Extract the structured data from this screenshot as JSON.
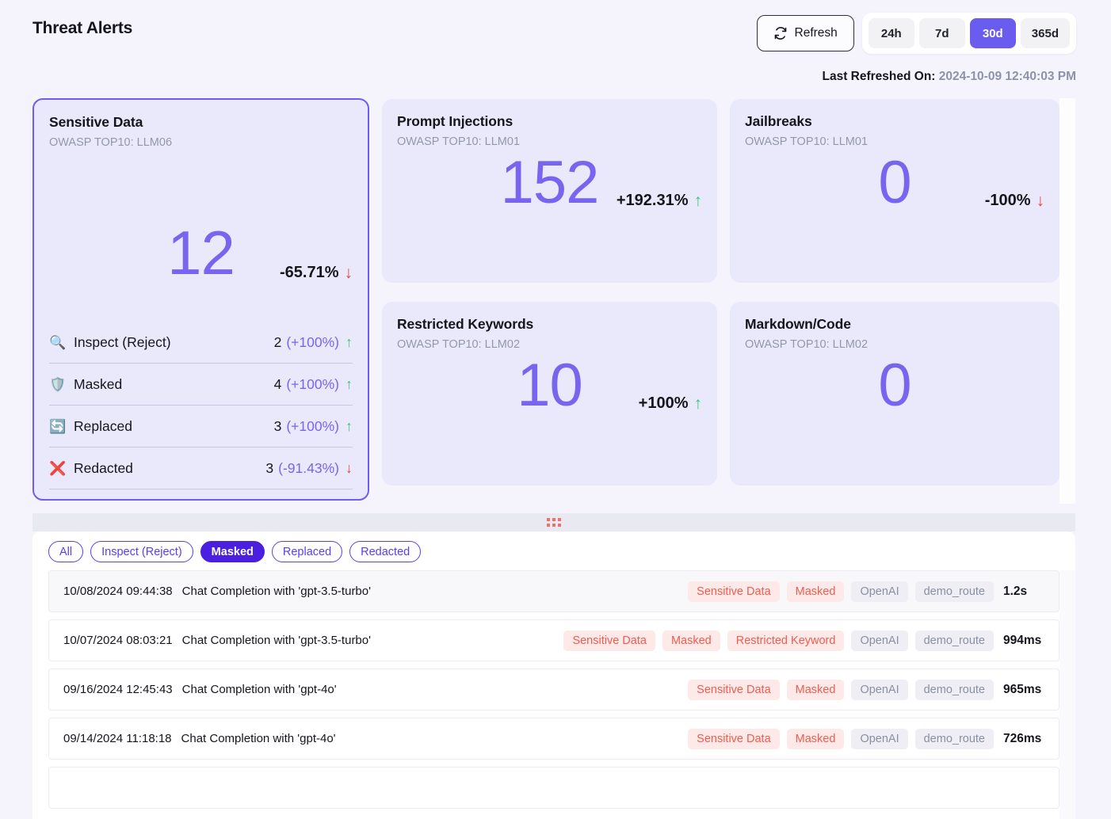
{
  "header": {
    "title": "Threat Alerts",
    "refresh_label": "Refresh",
    "refresh_icon": "refresh-icon",
    "ranges": [
      {
        "label": "24h",
        "active": false
      },
      {
        "label": "7d",
        "active": false
      },
      {
        "label": "30d",
        "active": true
      },
      {
        "label": "365d",
        "active": false
      }
    ],
    "last_refreshed_label": "Last Refreshed On:",
    "last_refreshed_value": "2024-10-09 12:40:03 PM"
  },
  "colors": {
    "accent": "#6b5cf0",
    "metric": "#7765f0",
    "up": "#3ec47f",
    "down": "#ef4136",
    "danger_tag_text": "#ef5c50",
    "danger_tag_bg": "#fdeae8",
    "neutral_tag_text": "#8a8fa3",
    "neutral_tag_bg": "#eeeef4",
    "page_bg": "#f5f4fd",
    "card_bg": "#eae9fc",
    "chip_active_bg": "#4a1fe0"
  },
  "cards": {
    "sensitive": {
      "title": "Sensitive Data",
      "subtitle": "OWASP TOP10: LLM06",
      "value": "12",
      "delta": "-65.71%",
      "direction": "down",
      "direction_glyph": "↓",
      "breakdown": [
        {
          "icon": "🔍",
          "icon_name": "magnifier-icon",
          "label": "Inspect (Reject)",
          "count": "2",
          "pct": "(+100%)",
          "direction": "up",
          "direction_glyph": "↑"
        },
        {
          "icon": "🛡️",
          "icon_name": "shield-icon",
          "label": "Masked",
          "count": "4",
          "pct": "(+100%)",
          "direction": "up",
          "direction_glyph": "↑"
        },
        {
          "icon": "🔄",
          "icon_name": "replace-arrows-icon",
          "label": "Replaced",
          "count": "3",
          "pct": "(+100%)",
          "direction": "up",
          "direction_glyph": "↑"
        },
        {
          "icon": "❌",
          "icon_name": "red-cross-icon",
          "label": "Redacted",
          "count": "3",
          "pct": "(-91.43%)",
          "direction": "down",
          "direction_glyph": "↓"
        }
      ]
    },
    "prompt_injections": {
      "title": "Prompt Injections",
      "subtitle": "OWASP TOP10: LLM01",
      "value": "152",
      "delta": "+192.31%",
      "direction": "up",
      "direction_glyph": "↑"
    },
    "jailbreaks": {
      "title": "Jailbreaks",
      "subtitle": "OWASP TOP10: LLM01",
      "value": "0",
      "delta": "-100%",
      "direction": "down",
      "direction_glyph": "↓"
    },
    "restricted_keywords": {
      "title": "Restricted Keywords",
      "subtitle": "OWASP TOP10: LLM02",
      "value": "10",
      "delta": "+100%",
      "direction": "up",
      "direction_glyph": "↑"
    },
    "markdown_code": {
      "title": "Markdown/Code",
      "subtitle": "OWASP TOP10: LLM02",
      "value": "0",
      "delta": "",
      "direction": "",
      "direction_glyph": ""
    }
  },
  "splitter": {
    "handle_icon": "drag-handle-icon"
  },
  "filters": [
    {
      "label": "All",
      "active": false
    },
    {
      "label": "Inspect (Reject)",
      "active": false
    },
    {
      "label": "Masked",
      "active": true
    },
    {
      "label": "Replaced",
      "active": false
    },
    {
      "label": "Redacted",
      "active": false
    }
  ],
  "log_rows": [
    {
      "timestamp": "10/08/2024 09:44:38",
      "description": "Chat Completion with 'gpt-3.5-turbo'",
      "tags": [
        {
          "label": "Sensitive Data",
          "kind": "danger"
        },
        {
          "label": "Masked",
          "kind": "danger"
        },
        {
          "label": "OpenAI",
          "kind": "neutral"
        },
        {
          "label": "demo_route",
          "kind": "neutral"
        }
      ],
      "latency": "1.2s",
      "highlighted": true
    },
    {
      "timestamp": "10/07/2024 08:03:21",
      "description": "Chat Completion with 'gpt-3.5-turbo'",
      "tags": [
        {
          "label": "Sensitive Data",
          "kind": "danger"
        },
        {
          "label": "Masked",
          "kind": "danger"
        },
        {
          "label": "Restricted Keyword",
          "kind": "danger"
        },
        {
          "label": "OpenAI",
          "kind": "neutral"
        },
        {
          "label": "demo_route",
          "kind": "neutral"
        }
      ],
      "latency": "994ms",
      "highlighted": false
    },
    {
      "timestamp": "09/16/2024 12:45:43",
      "description": "Chat Completion with 'gpt-4o'",
      "tags": [
        {
          "label": "Sensitive Data",
          "kind": "danger"
        },
        {
          "label": "Masked",
          "kind": "danger"
        },
        {
          "label": "OpenAI",
          "kind": "neutral"
        },
        {
          "label": "demo_route",
          "kind": "neutral"
        }
      ],
      "latency": "965ms",
      "highlighted": false
    },
    {
      "timestamp": "09/14/2024 11:18:18",
      "description": "Chat Completion with 'gpt-4o'",
      "tags": [
        {
          "label": "Sensitive Data",
          "kind": "danger"
        },
        {
          "label": "Masked",
          "kind": "danger"
        },
        {
          "label": "OpenAI",
          "kind": "neutral"
        },
        {
          "label": "demo_route",
          "kind": "neutral"
        }
      ],
      "latency": "726ms",
      "highlighted": false
    }
  ]
}
